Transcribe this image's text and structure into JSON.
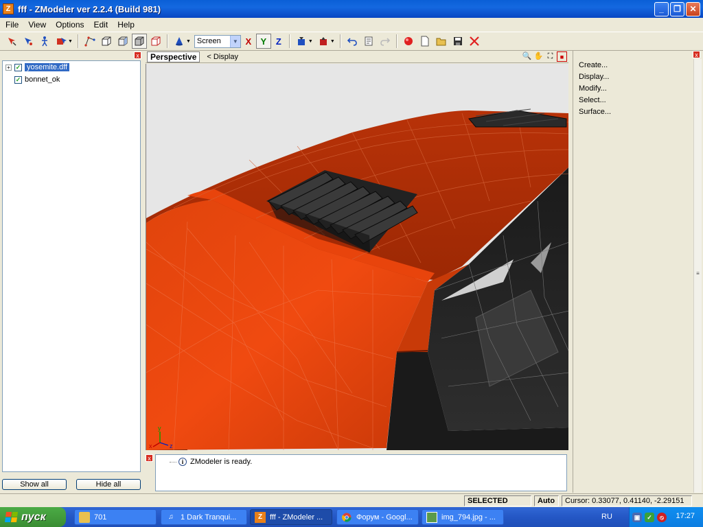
{
  "window": {
    "title": "fff - ZModeler ver 2.2.4 (Build 981)",
    "app_icon_letter": "Z",
    "minimize": "_",
    "maximize": "❐",
    "close": "✕"
  },
  "menu": [
    "File",
    "View",
    "Options",
    "Edit",
    "Help"
  ],
  "toolbar": {
    "icons_group1": [
      "select-vertex-icon",
      "select-object-icon",
      "move-icon",
      "multi-select-icon"
    ],
    "icons_group2": [
      "vertices-mode-icon",
      "edges-mode-icon",
      "faces-mode-icon",
      "objects-mode-icon",
      "mesh-mode-icon"
    ],
    "icon_group3": "cone-icon",
    "coord_system": "Screen",
    "axis_x": "X",
    "axis_y": "Y",
    "axis_z": "Z"
  },
  "left_panel": {
    "close": "x",
    "tree": [
      {
        "label": "yosemite.dff",
        "checked": true,
        "expandable": true,
        "selected": true
      },
      {
        "label": "bonnet_ok",
        "checked": true,
        "expandable": false,
        "selected": false
      }
    ],
    "show_all": "Show all",
    "hide_all": "Hide all"
  },
  "viewport": {
    "tab": "Perspective",
    "display_link": "<  Display",
    "axis_labels": {
      "x": "x",
      "y": "y",
      "z": "z"
    }
  },
  "log": {
    "close": "x",
    "message": "ZModeler is ready."
  },
  "right_panel": {
    "close": "x",
    "items": [
      "Create...",
      "Display...",
      "Modify...",
      "Select...",
      "Surface..."
    ]
  },
  "status": {
    "mode": "SELECTED MODE",
    "auto": "Auto",
    "cursor": "Cursor: 0.33077, 0.41140, -2.29151"
  },
  "taskbar": {
    "start": "пуск",
    "tasks": [
      {
        "label": "701",
        "icon": "folder-icon"
      },
      {
        "label": "1 Dark Tranqui...",
        "icon": "music-icon"
      },
      {
        "label": "fff - ZModeler ...",
        "icon": "zmodeler-icon"
      },
      {
        "label": "Форум - Googl...",
        "icon": "chrome-icon"
      },
      {
        "label": "img_794.jpg - ...",
        "icon": "image-icon"
      }
    ],
    "language": "RU",
    "clock": "17:27"
  }
}
